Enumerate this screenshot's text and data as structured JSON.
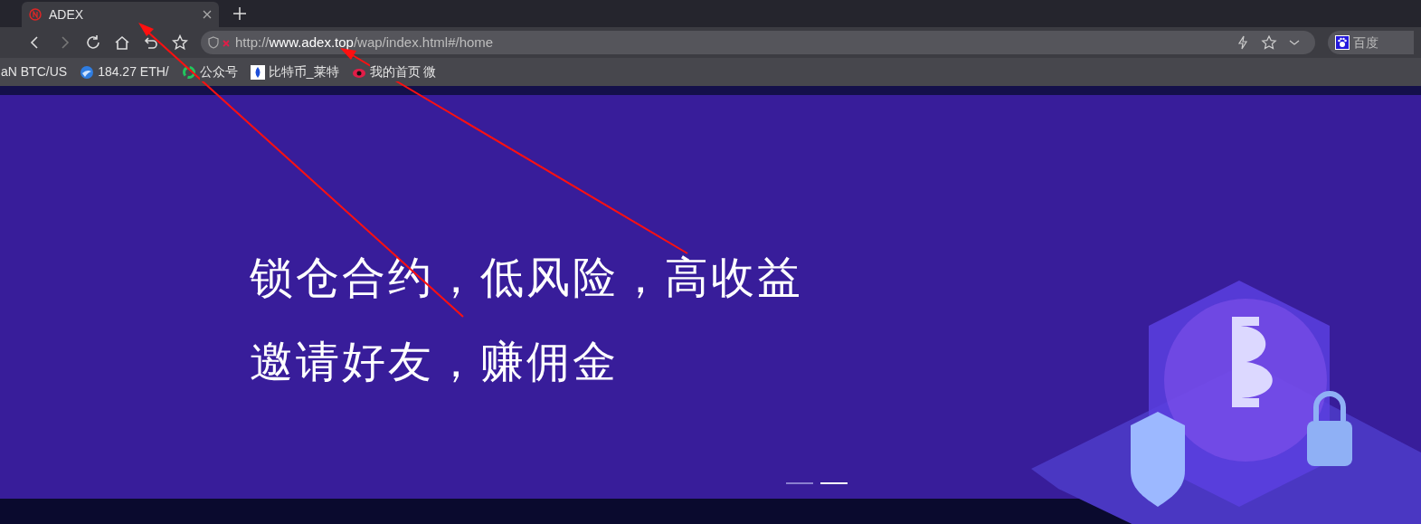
{
  "tab": {
    "title": "ADEX"
  },
  "address_bar": {
    "scheme": "http://",
    "host": "www.adex.top",
    "path": "/wap/index.html#/home"
  },
  "search_engine": {
    "label": "百度"
  },
  "bookmarks": [
    {
      "label": "aN BTC/US",
      "kind": "plain"
    },
    {
      "label": "184.27 ETH/",
      "kind": "globe"
    },
    {
      "label": "公众号",
      "kind": "ring"
    },
    {
      "label": "比特币_莱特",
      "kind": "drop"
    },
    {
      "label": "我的首页 微",
      "kind": "eye"
    }
  ],
  "banner": {
    "lines": [
      "锁仓合约，低风险，高收益",
      "邀请好友，赚佣金"
    ],
    "slides": [
      {
        "selected": false
      },
      {
        "selected": true
      }
    ]
  }
}
